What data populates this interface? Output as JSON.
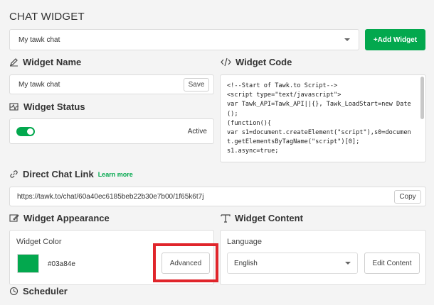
{
  "header": {
    "title": "CHAT WIDGET"
  },
  "widget_select": {
    "value": "My tawk chat"
  },
  "add_widget": {
    "label": "+Add Widget"
  },
  "widget_name": {
    "title": "Widget Name",
    "value": "My tawk chat",
    "save_label": "Save"
  },
  "widget_status": {
    "title": "Widget Status",
    "status": "Active"
  },
  "widget_code": {
    "title": "Widget Code",
    "code": "<!--Start of Tawk.to Script-->\n<script type=\"text/javascript\">\nvar Tawk_API=Tawk_API||{}, Tawk_LoadStart=new Date();\n(function(){\nvar s1=document.createElement(\"script\"),s0=document.getElementsByTagName(\"script\")[0];\ns1.async=true;"
  },
  "direct_link": {
    "title": "Direct Chat Link",
    "learn_more": "Learn more",
    "url": "https://tawk.to/chat/60a40ec6185beb22b30e7b00/1f65k6t7j",
    "copy_label": "Copy"
  },
  "appearance": {
    "title": "Widget Appearance",
    "color_label": "Widget Color",
    "color_value": "#03a84e",
    "advanced_label": "Advanced"
  },
  "content": {
    "title": "Widget Content",
    "language_label": "Language",
    "language_value": "English",
    "edit_label": "Edit Content"
  },
  "scheduler": {
    "title": "Scheduler"
  },
  "colors": {
    "accent": "#03a84e",
    "highlight": "#e0252b"
  }
}
